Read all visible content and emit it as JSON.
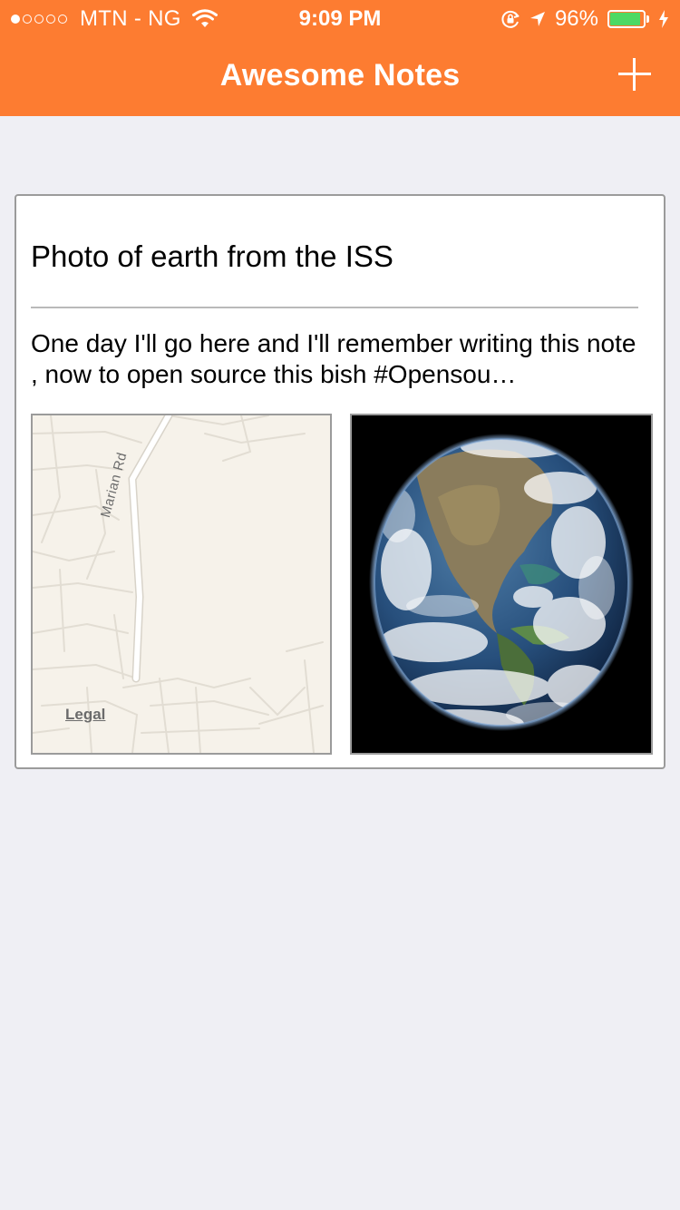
{
  "status_bar": {
    "carrier": "MTN - NG",
    "time": "9:09 PM",
    "battery": "96%",
    "battery_level": 0.96,
    "signal_bars_filled": 1,
    "signal_bars_total": 5
  },
  "nav": {
    "title": "Awesome Notes",
    "add_icon": "plus-icon"
  },
  "note": {
    "title": "Photo of earth from the ISS",
    "body": "One day I'll go here and I'll remember writing this note ,  now to open source this bish #Opensou…",
    "map": {
      "road_label": "Marian Rd",
      "legal_label": "Legal"
    },
    "photo_subject": "earth-globe-image"
  },
  "colors": {
    "accent": "#fd7c31",
    "background": "#efeff4",
    "battery_fill": "#4cd964",
    "map_background": "#f6f2ea"
  }
}
